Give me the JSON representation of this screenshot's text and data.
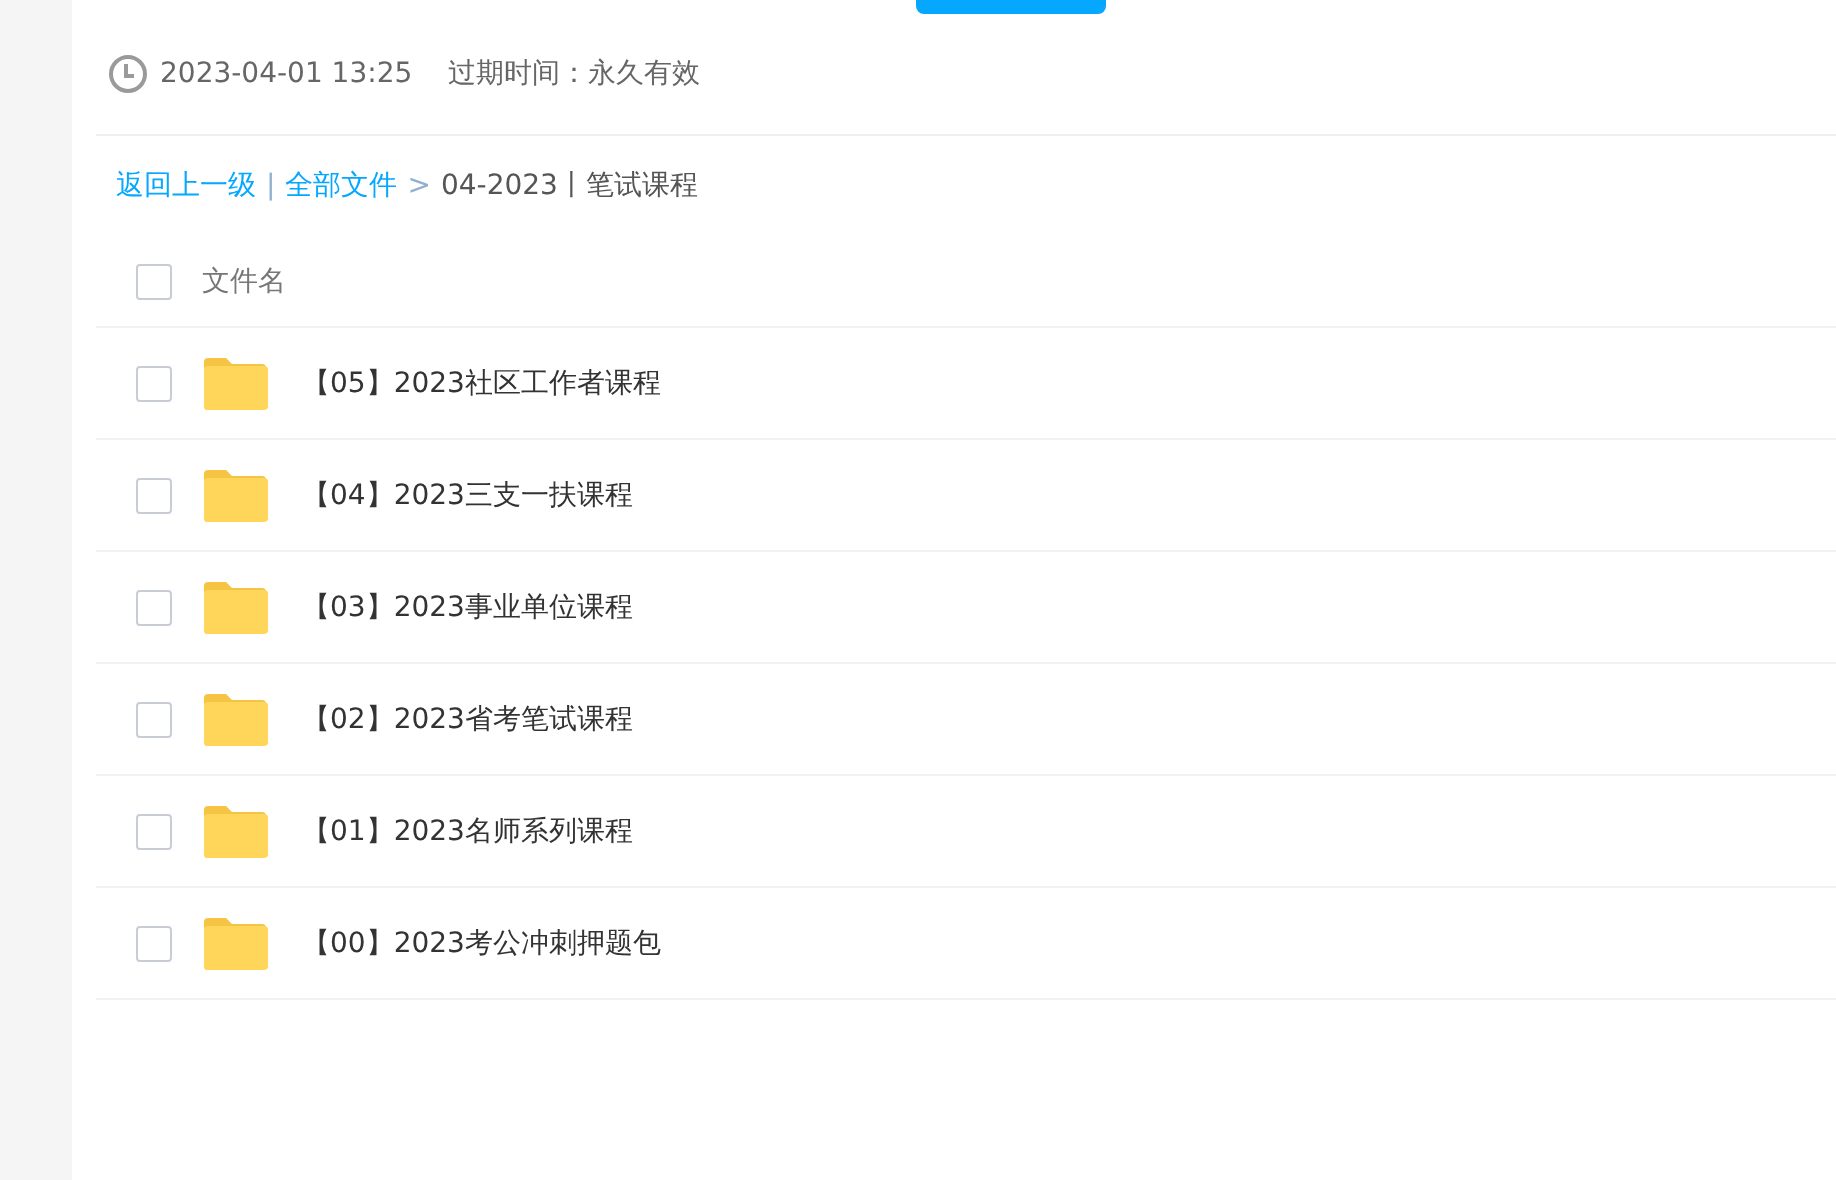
{
  "share_info": {
    "date": "2023-04-01 13:25",
    "expiry": "过期时间：永久有效"
  },
  "breadcrumb": [
    {
      "kind": "link",
      "text": "返回上一级"
    },
    {
      "kind": "separator",
      "text": "|"
    },
    {
      "kind": "link",
      "text": "全部文件"
    },
    {
      "kind": "separator",
      "text": ">"
    },
    {
      "kind": "current",
      "text": "04-2023丨笔试课程"
    }
  ],
  "table": {
    "header": {
      "label": "文件名",
      "checked": false
    },
    "rows": [
      {
        "name": "【05】2023社区工作者课程",
        "checked": false
      },
      {
        "name": "【04】2023三支一扶课程",
        "checked": false
      },
      {
        "name": "【03】2023事业单位课程",
        "checked": false
      },
      {
        "name": "【02】2023省考笔试课程",
        "checked": false
      },
      {
        "name": "【01】2023名师系列课程",
        "checked": false
      },
      {
        "name": "【00】2023考公冲刺押题包",
        "checked": false
      }
    ]
  }
}
